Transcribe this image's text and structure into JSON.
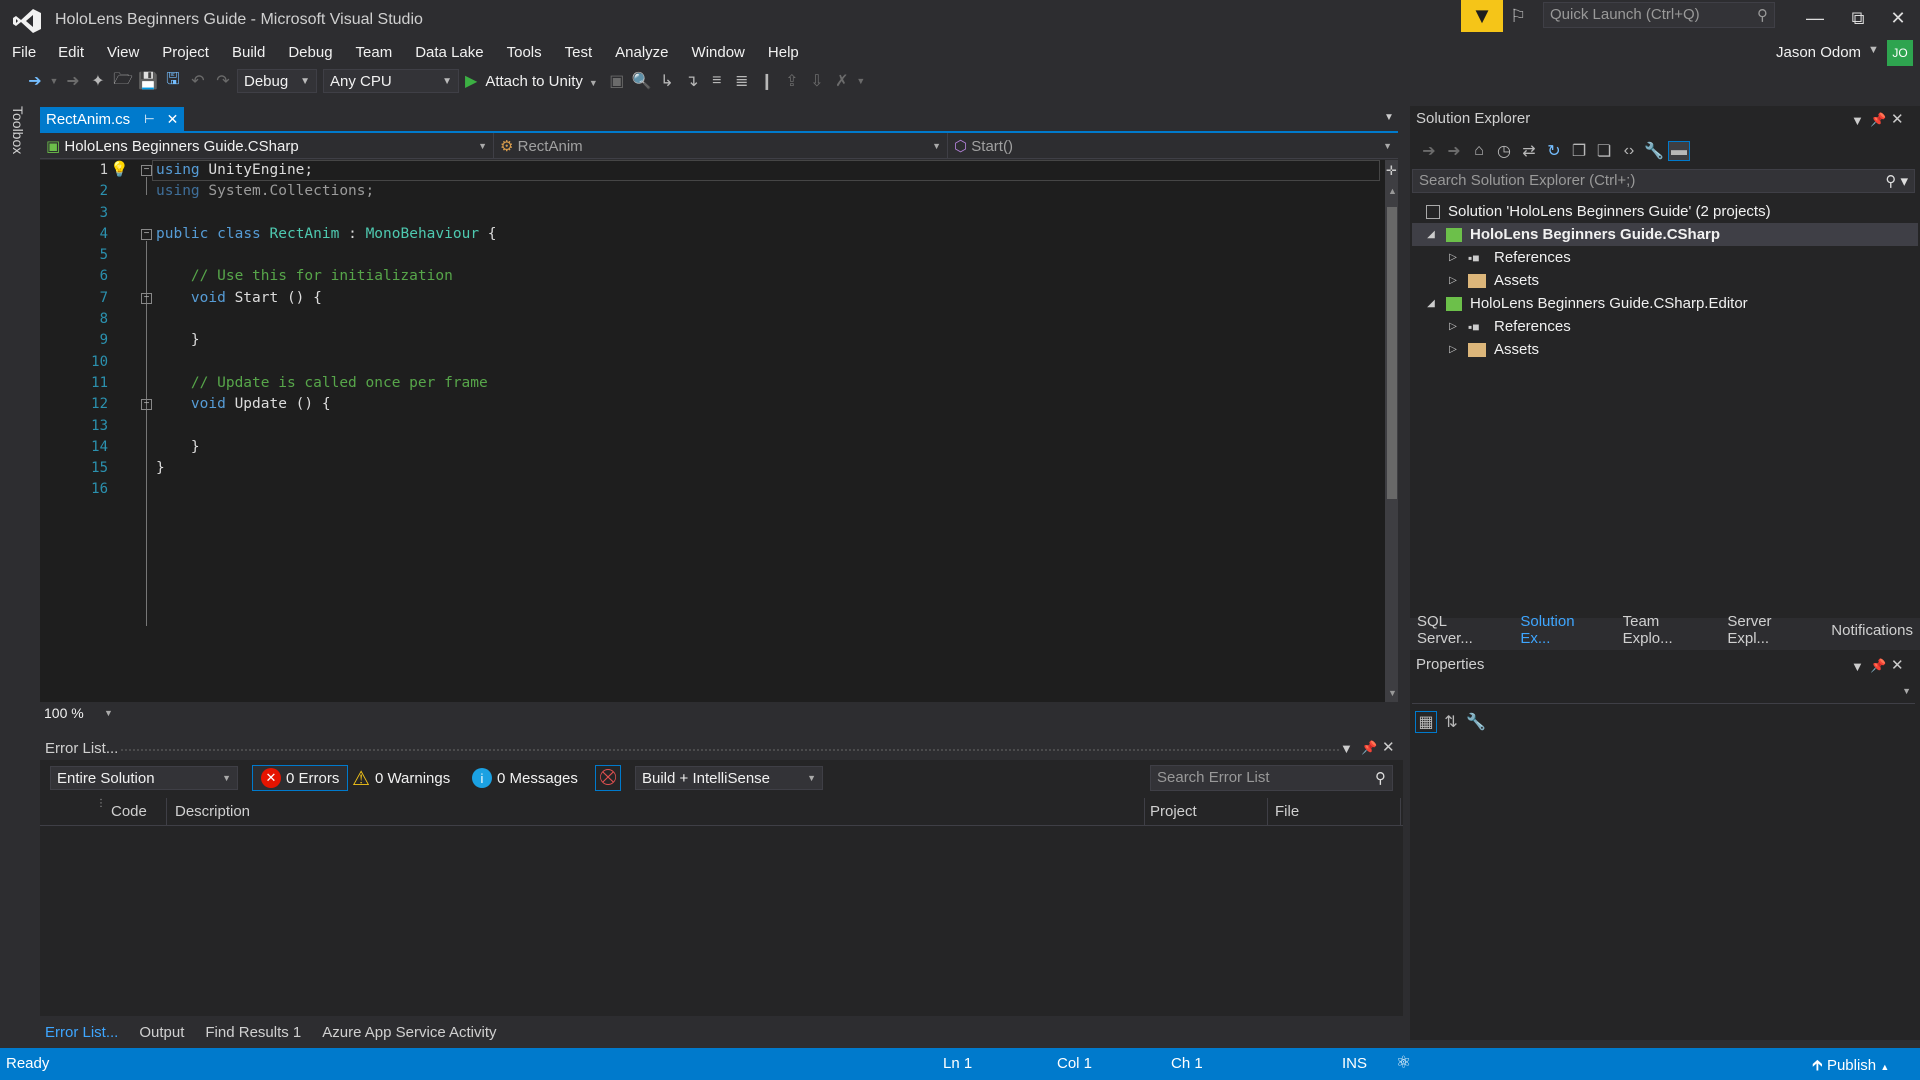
{
  "window": {
    "title": "HoloLens Beginners Guide - Microsoft Visual Studio",
    "quick_launch_placeholder": "Quick Launch (Ctrl+Q)",
    "user": "Jason Odom",
    "avatar_initials": "JO"
  },
  "menu": [
    "File",
    "Edit",
    "View",
    "Project",
    "Build",
    "Debug",
    "Team",
    "Data Lake",
    "Tools",
    "Test",
    "Analyze",
    "Window",
    "Help"
  ],
  "toolbar": {
    "configuration": "Debug",
    "platform": "Any CPU",
    "attach_label": "Attach to Unity"
  },
  "toolbox_label": "Toolbox",
  "editor": {
    "tab_name": "RectAnim.cs",
    "nav_project": "HoloLens Beginners Guide.CSharp",
    "nav_class": "RectAnim",
    "nav_member": "Start()",
    "zoom": "100 %",
    "line_numbers": [
      "1",
      "2",
      "3",
      "4",
      "5",
      "6",
      "7",
      "8",
      "9",
      "10",
      "11",
      "12",
      "13",
      "14",
      "15",
      "16"
    ]
  },
  "error_list": {
    "title": "Error List...",
    "scope": "Entire Solution",
    "errors": "0 Errors",
    "warnings": "0 Warnings",
    "messages": "0 Messages",
    "source": "Build + IntelliSense",
    "search_placeholder": "Search Error List",
    "columns": {
      "code": "Code",
      "description": "Description",
      "project": "Project",
      "file": "File"
    }
  },
  "bottom_tabs": [
    "Error List...",
    "Output",
    "Find Results 1",
    "Azure App Service Activity"
  ],
  "solution_explorer": {
    "title": "Solution Explorer",
    "search_placeholder": "Search Solution Explorer (Ctrl+;)",
    "tree": {
      "solution": "Solution 'HoloLens Beginners Guide' (2 projects)",
      "project1": "HoloLens Beginners Guide.CSharp",
      "p1_references": "References",
      "p1_assets": "Assets",
      "project2": "HoloLens Beginners Guide.CSharp.Editor",
      "p2_references": "References",
      "p2_assets": "Assets"
    }
  },
  "side_tabs": [
    "SQL Server...",
    "Solution Ex...",
    "Team Explo...",
    "Server Expl...",
    "Notifications"
  ],
  "properties": {
    "title": "Properties"
  },
  "status": {
    "ready": "Ready",
    "ln": "Ln 1",
    "col": "Col 1",
    "ch": "Ch 1",
    "ins": "INS",
    "publish": "Publish"
  },
  "colors": {
    "accent": "#007acc",
    "background": "#2d2d30",
    "editor_bg": "#1e1e1e",
    "keyword": "#569cd6",
    "type": "#4ec9b0",
    "comment": "#57a64a"
  }
}
